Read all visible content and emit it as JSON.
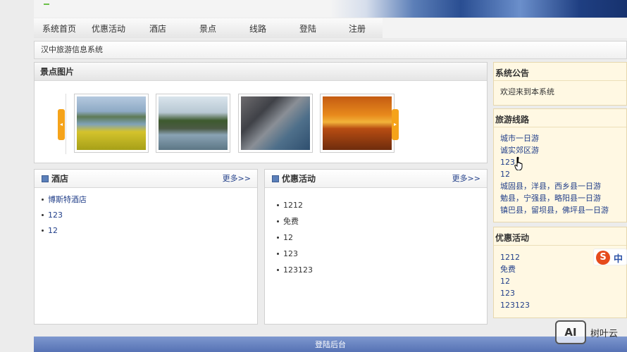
{
  "nav": {
    "items": [
      "系统首页",
      "优惠活动",
      "酒店",
      "景点",
      "线路",
      "登陆",
      "注册"
    ]
  },
  "breadcrumb": "汉中旅游信息系统",
  "gallery": {
    "title": "景点图片"
  },
  "hotels": {
    "title": "酒店",
    "more": "更多>>",
    "items": [
      "博斯特酒店",
      "123",
      "12"
    ]
  },
  "promos": {
    "title": "优惠活动",
    "more": "更多>>",
    "items": [
      "1212",
      "免费",
      "12",
      "123",
      "123123"
    ]
  },
  "notice": {
    "title": "系统公告",
    "text": "欢迎来到本系统"
  },
  "routes": {
    "title": "旅游线路",
    "items": [
      "城市一日游",
      "诚实郊区游",
      "123",
      "12",
      "城固县，洋县，西乡县一日游",
      "勉县，宁强县，略阳县一日游",
      "镇巴县，留坝县，佛坪县一日游"
    ]
  },
  "side_promos": {
    "title": "优惠活动",
    "items": [
      "1212",
      "免费",
      "12",
      "123",
      "123123"
    ]
  },
  "footer": "登陆后台",
  "ime": {
    "s": "S",
    "lang": "中"
  },
  "watermark": {
    "logo": "AI",
    "text": "树叶云"
  },
  "colors": {
    "link": "#23408a",
    "arrow": "#f5a31a",
    "footer": "#5672b4"
  }
}
